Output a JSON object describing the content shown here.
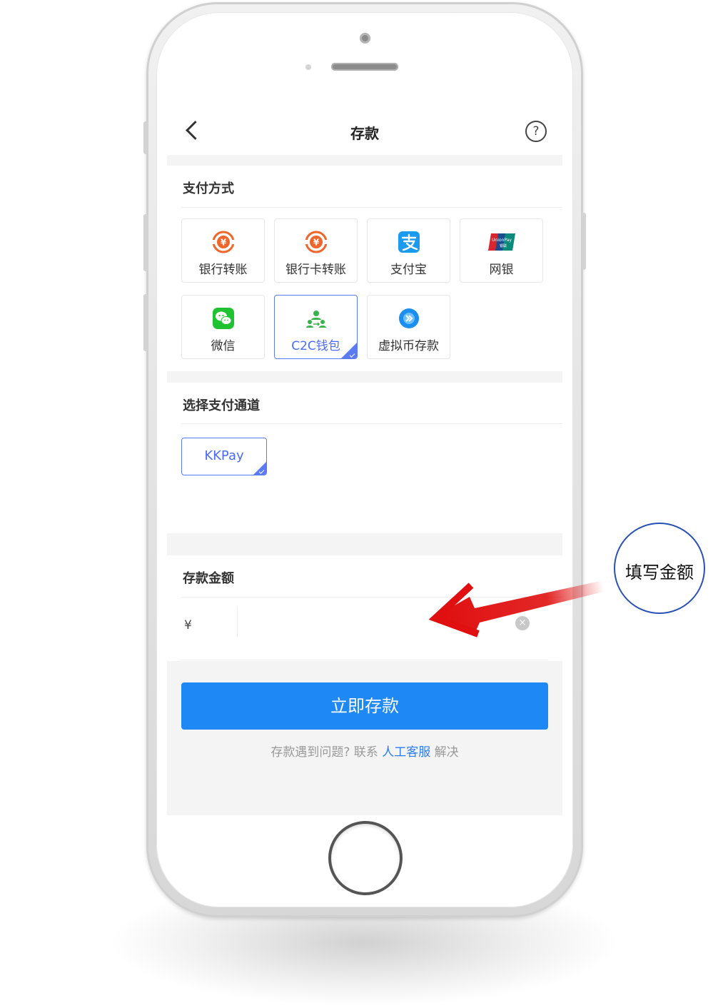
{
  "header": {
    "title": "存款",
    "help_symbol": "?"
  },
  "payment_methods": {
    "title": "支付方式",
    "options": [
      {
        "label": "银行转账",
        "icon": "yuan-transfer-icon",
        "selected": false
      },
      {
        "label": "银行卡转账",
        "icon": "yuan-transfer-icon",
        "selected": false
      },
      {
        "label": "支付宝",
        "icon": "alipay-icon",
        "selected": false
      },
      {
        "label": "网银",
        "icon": "unionpay-icon",
        "selected": false
      },
      {
        "label": "微信",
        "icon": "wechat-icon",
        "selected": false
      },
      {
        "label": "C2C钱包",
        "icon": "c2c-wallet-icon",
        "selected": true
      },
      {
        "label": "虚拟币存款",
        "icon": "crypto-coin-icon",
        "selected": false
      }
    ]
  },
  "channel": {
    "title": "选择支付通道",
    "options": [
      {
        "label": "KKPay",
        "selected": true
      }
    ]
  },
  "amount": {
    "title": "存款金额",
    "currency": "¥",
    "value": "",
    "clear_symbol": "×"
  },
  "submit_label": "立即存款",
  "help": {
    "prefix": "存款遇到问题? 联系",
    "link": "人工客服",
    "suffix": "解决"
  },
  "callout": {
    "text": "填写金额"
  },
  "colors": {
    "accent": "#1e88f5",
    "selected_border": "#5b7bf5",
    "annotation_arrow": "#e01010",
    "callout_border": "#2850b5"
  }
}
